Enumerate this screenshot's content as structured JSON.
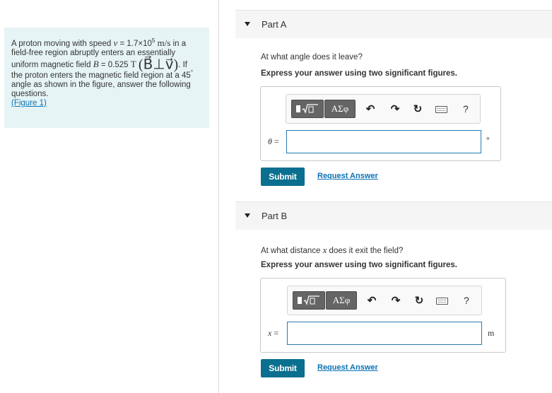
{
  "problem": {
    "line1_a": "A proton moving with speed ",
    "line1_var": "v",
    "line1_eq": " = 1.7×10",
    "line1_exp": "5",
    "line1_unit": " m/s",
    "line1_b": " in a",
    "line2": "field-free region abruptly enters an essentially",
    "line3_a": "uniform magnetic field ",
    "line3_var": "B",
    "line3_eq": " = 0.525 ",
    "line3_unit": "T",
    "line3_paren": "(B⃗⊥v⃗)",
    "line3_b": ". If",
    "line4_a": "the proton enters the magnetic field region at a 45",
    "line4_deg": "°",
    "line5": "angle as shown in the figure, answer the following",
    "line6": "questions.",
    "figure_link": "(Figure 1)"
  },
  "part_a": {
    "title": "Part A",
    "question": "At what angle does it leave?",
    "instruction": "Express your answer using two significant figures.",
    "var": "θ",
    "eq": " =",
    "unit": "°",
    "input_value": "",
    "submit": "Submit",
    "request": "Request Answer"
  },
  "part_b": {
    "title": "Part B",
    "question_a": "At what distance ",
    "question_var": "x",
    "question_b": " does it exit the field?",
    "instruction": "Express your answer using two significant figures.",
    "var": "x",
    "eq": " =",
    "unit": "m",
    "input_value": "",
    "submit": "Submit",
    "request": "Request Answer"
  },
  "toolbar": {
    "templates_label": "▮√▯",
    "greek_label": "ΑΣφ",
    "undo": "↶",
    "redo": "↷",
    "reset": "↻",
    "help": "?"
  },
  "icons": [
    "collapse-triangle-icon",
    "templates-icon",
    "greek-symbols-icon",
    "undo-icon",
    "redo-icon",
    "reset-icon",
    "keyboard-icon",
    "help-icon"
  ],
  "colors": {
    "problem_bg": "#e6f4f5",
    "submit_bg": "#0b6f8f",
    "link": "#0a72b5",
    "input_border": "#2a7ab0"
  }
}
